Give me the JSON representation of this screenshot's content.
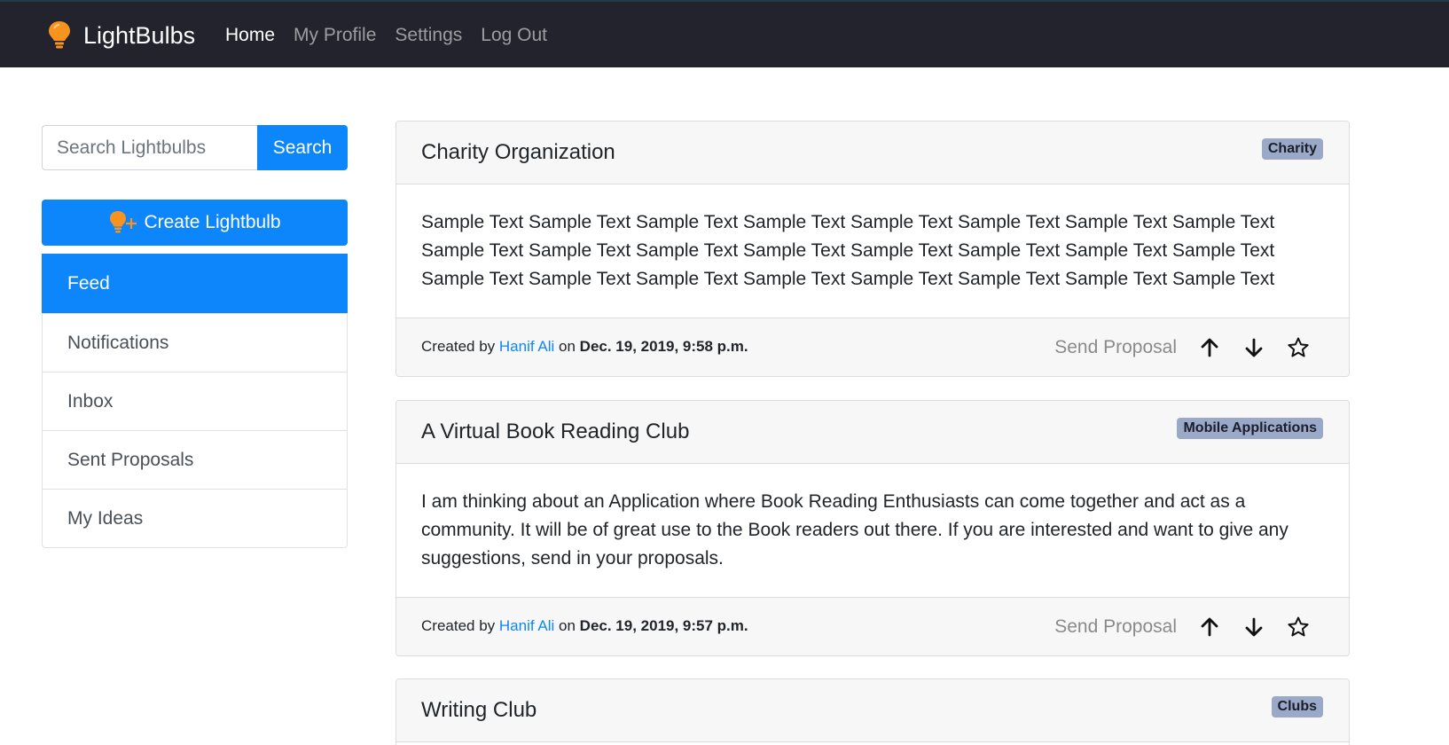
{
  "navbar": {
    "brand": "LightBulbs",
    "brand_icon": "lightbulb-icon",
    "links": [
      {
        "label": "Home",
        "active": true
      },
      {
        "label": "My Profile",
        "active": false
      },
      {
        "label": "Settings",
        "active": false
      },
      {
        "label": "Log Out",
        "active": false
      }
    ]
  },
  "sidebar": {
    "search": {
      "placeholder": "Search Lightbulbs",
      "button": "Search"
    },
    "create_button": "Create Lightbulb",
    "items": [
      {
        "label": "Feed",
        "active": true
      },
      {
        "label": "Notifications",
        "active": false
      },
      {
        "label": "Inbox",
        "active": false
      },
      {
        "label": "Sent Proposals",
        "active": false
      },
      {
        "label": "My Ideas",
        "active": false
      }
    ]
  },
  "posts": [
    {
      "title": "Charity Organization",
      "tag": "Charity",
      "body": "Sample Text Sample Text Sample Text Sample Text Sample Text Sample Text Sample Text Sample Text Sample Text Sample Text Sample Text Sample Text Sample Text Sample Text Sample Text Sample Text Sample Text Sample Text Sample Text Sample Text Sample Text Sample Text Sample Text Sample Text",
      "created_by_label": "Created by",
      "author": "Hanif Ali",
      "on_label": "on",
      "date": "Dec. 19, 2019, 9:58 p.m.",
      "send_proposal": "Send Proposal"
    },
    {
      "title": "A Virtual Book Reading Club",
      "tag": "Mobile Applications",
      "body": "I am thinking about an Application where Book Reading Enthusiasts can come together and act as a community. It will be of great use to the Book readers out there. If you are interested and want to give any suggestions, send in your proposals.",
      "created_by_label": "Created by",
      "author": "Hanif Ali",
      "on_label": "on",
      "date": "Dec. 19, 2019, 9:57 p.m.",
      "send_proposal": "Send Proposal"
    },
    {
      "title": "Writing Club",
      "tag": "Clubs"
    }
  ],
  "colors": {
    "navbar_bg": "#23232d",
    "primary": "#0d86fb",
    "bulb": "#f7931e",
    "badge_bg": "#9aa9c8"
  }
}
